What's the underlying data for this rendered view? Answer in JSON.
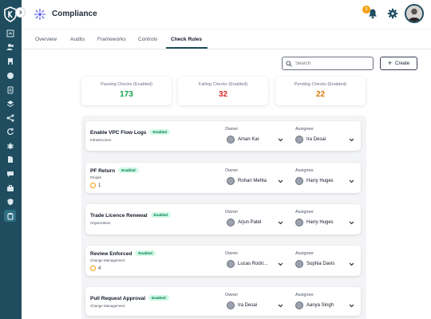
{
  "header": {
    "title": "Compliance",
    "notification_count": "3"
  },
  "tabs": [
    {
      "label": "Overview"
    },
    {
      "label": "Audits"
    },
    {
      "label": "Frameworks"
    },
    {
      "label": "Controls"
    },
    {
      "label": "Check Rules"
    }
  ],
  "active_tab": "Check Rules",
  "search": {
    "placeholder": "Search"
  },
  "create_label": "Create",
  "stats": [
    {
      "label": "Passing Checks (Enabled)",
      "value": "173",
      "color": "#16a34a"
    },
    {
      "label": "Failing Checks (Enabled)",
      "value": "32",
      "color": "#dc2626"
    },
    {
      "label": "Pending Checks (Enabled)",
      "value": "22",
      "color": "#d97706"
    }
  ],
  "columns": {
    "owner": "Owner",
    "assignee": "Assignee"
  },
  "rules": [
    {
      "name": "Enable VPC Flow Logs",
      "status": "Enabled",
      "category": "Infrastructure",
      "count": "",
      "owner": "Aman Kar",
      "assignee": "Ira Desai"
    },
    {
      "name": "PF Return",
      "status": "Enabled",
      "category": "People",
      "count": "1",
      "owner": "Rohan Mehta",
      "assignee": "Harry Huges"
    },
    {
      "name": "Trade Licence Renewal",
      "status": "Enabled",
      "category": "Organization",
      "count": "",
      "owner": "Arjun Patel",
      "assignee": "Harry Huges"
    },
    {
      "name": "Review Enforced",
      "status": "Enabled",
      "category": "Change Management",
      "count": "4",
      "owner": "Lucas Rodri...",
      "assignee": "Sophia Davis"
    },
    {
      "name": "Pull Request Approval",
      "status": "Enabled",
      "category": "Change Management",
      "count": "",
      "owner": "Ira Desai",
      "assignee": "Aanya Singh"
    }
  ],
  "colors": {
    "sidebar": "#1f4d5f",
    "accent": "#1f4d5f",
    "enabled_pill": "#d1fae5"
  },
  "icons": {
    "sidebar": [
      "dashboard-icon",
      "people-icon",
      "building-icon",
      "globe-icon",
      "document-icon",
      "layers-icon",
      "share-icon",
      "refresh-icon",
      "bug-icon",
      "file-icon",
      "chat-icon",
      "briefcase-icon",
      "shield-icon",
      "clipboard-icon"
    ]
  }
}
